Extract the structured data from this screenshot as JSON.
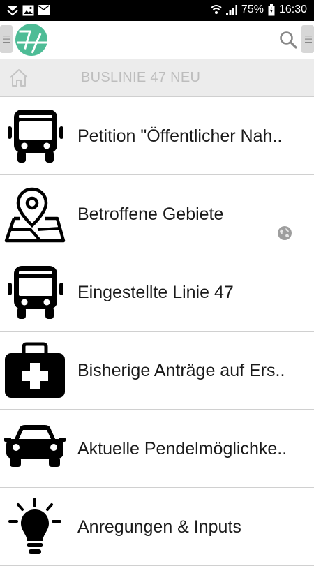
{
  "status_bar": {
    "battery": "75%",
    "time": "16:30",
    "left_icons": [
      "notification-icon",
      "image-icon",
      "mail-icon"
    ],
    "right_icons": [
      "wifi-icon",
      "signal-icon",
      "battery-icon"
    ]
  },
  "app_bar": {
    "logo_icon": "app-logo-icon",
    "search_icon": "search-icon",
    "accent_color": "#4ebc96"
  },
  "breadcrumb": {
    "home_icon": "home-icon",
    "title": "BUSLINIE 47 NEU"
  },
  "menu": {
    "items": [
      {
        "label": "Petition \"Öffentlicher Nah..",
        "icon": "bus-icon"
      },
      {
        "label": "Betroffene Gebiete",
        "icon": "map-pin-icon"
      },
      {
        "label": "Eingestellte Linie 47",
        "icon": "bus-icon"
      },
      {
        "label": "Bisherige Anträge auf Ers..",
        "icon": "first-aid-kit-icon"
      },
      {
        "label": "Aktuelle Pendelmöglichke..",
        "icon": "car-icon"
      },
      {
        "label": "Anregungen & Inputs",
        "icon": "lightbulb-icon"
      }
    ]
  }
}
